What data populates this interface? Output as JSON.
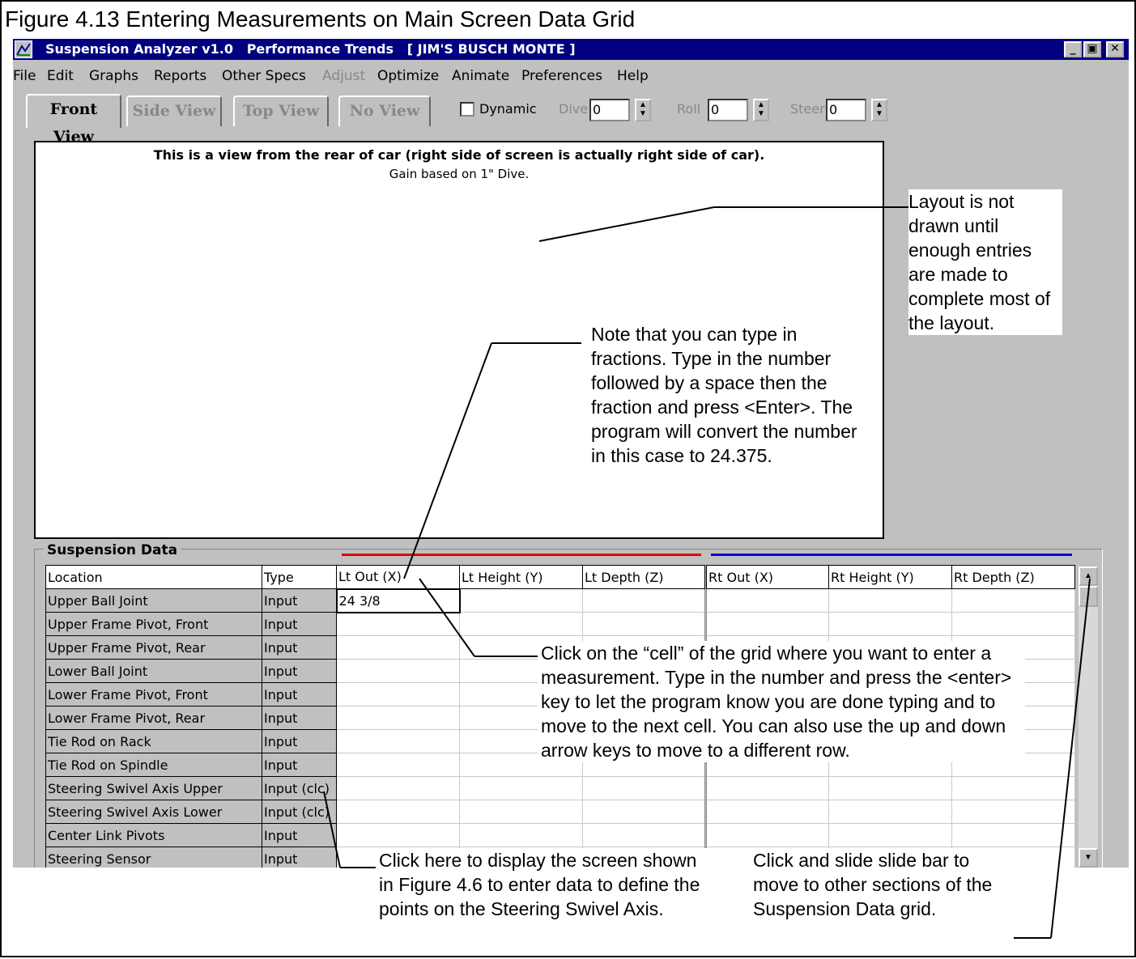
{
  "figure_title": "Figure 4.13  Entering Measurements on Main Screen Data Grid",
  "window": {
    "title": "Suspension Analyzer v1.0   Performance Trends   [ JIM'S BUSCH MONTE ]",
    "min_label": "_",
    "max_label": "▣",
    "close_label": "✕"
  },
  "menu": [
    "File",
    "Edit",
    "Graphs",
    "Reports",
    "Other Specs",
    "Adjust",
    "Optimize",
    "Animate",
    "Preferences",
    "Help"
  ],
  "tabs": [
    "Front View",
    "Side View",
    "Top View",
    "No View"
  ],
  "dynamic_label": "Dynamic",
  "dive": {
    "label": "Dive",
    "value": "0"
  },
  "roll": {
    "label": "Roll",
    "value": "0"
  },
  "steer": {
    "label": "Steer",
    "value": "0"
  },
  "view": {
    "title": "This is a view from the rear of car (right side of screen is actually right side of car).",
    "subtitle": "Gain based on 1\" Dive."
  },
  "suspension_data": {
    "title": "Suspension Data",
    "headers": [
      "Location",
      "Type",
      "Lt Out (X)",
      "Lt Height (Y)",
      "Lt Depth (Z)",
      "Rt Out (X)",
      "Rt Height (Y)",
      "Rt Depth (Z)"
    ],
    "rows": [
      [
        "Upper Ball Joint",
        "Input",
        "24 3/8"
      ],
      [
        "Upper Frame Pivot, Front",
        "Input",
        ""
      ],
      [
        "Upper Frame Pivot, Rear",
        "Input",
        ""
      ],
      [
        "Lower Ball Joint",
        "Input",
        ""
      ],
      [
        "Lower Frame Pivot, Front",
        "Input",
        ""
      ],
      [
        "Lower Frame Pivot, Rear",
        "Input",
        ""
      ],
      [
        "Tie Rod on Rack",
        "Input",
        ""
      ],
      [
        "Tie Rod on Spindle",
        "Input",
        ""
      ],
      [
        "Steering Swivel Axis Upper",
        "Input (clc)",
        ""
      ],
      [
        "Steering Swivel Axis Lower",
        "Input (clc)",
        ""
      ],
      [
        "Center Link Pivots",
        "Input",
        ""
      ],
      [
        "Steering Sensor",
        "Input",
        ""
      ]
    ]
  },
  "callouts": {
    "layout": "Layout is not drawn until enough entries are made to complete most of the layout.",
    "fractions": "Note that you can type in fractions.  Type in the number followed by a space then the fraction and press <Enter>.  The program will convert the number in this case to 24.375.",
    "cell": "Click on the “cell” of the grid where you want to enter a measurement.   Type in the number and press the <enter> key to let the program know you are done typing and to move to the next cell.  You can also use the up and down arrow keys to move to a different row.",
    "click_here": "Click here to display the screen shown in Figure 4.6 to enter data to define the points on the Steering Swivel Axis.",
    "slide": "Click and slide slide bar to move to other sections of the Suspension Data grid."
  }
}
